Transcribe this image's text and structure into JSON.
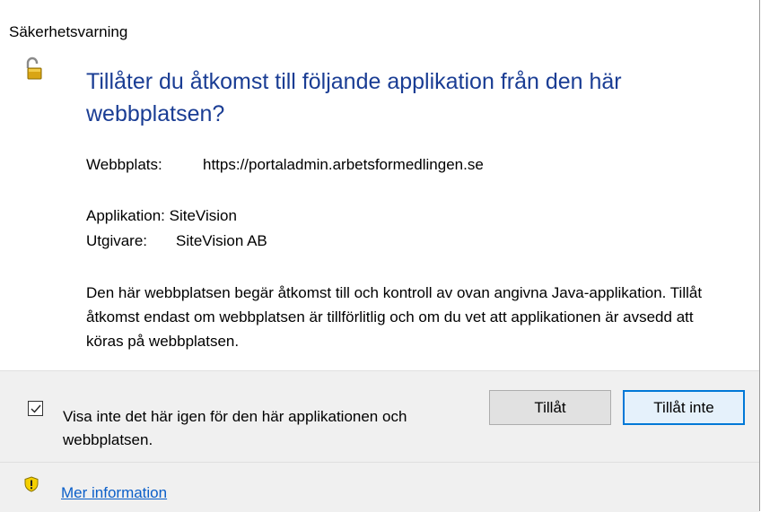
{
  "dialog": {
    "title": "Säkerhetsvarning",
    "heading": "Tillåter du åtkomst till följande applikation från den här webbplatsen?",
    "site_label": "Webbplats:",
    "site_value": "https://portaladmin.arbetsformedlingen.se",
    "app_label": "Applikation:",
    "app_value": "SiteVision",
    "publisher_label": "Utgivare:",
    "publisher_value": "SiteVision AB",
    "description": "Den här webbplatsen begär åtkomst till och kontroll av ovan angivna Java-applikation. Tillåt åtkomst endast om webbplatsen är tillförlitlig och om du vet att applikationen är avsedd att köras på webbplatsen."
  },
  "footer": {
    "checkbox_label": "Visa inte det här igen för den här applikationen och webbplatsen.",
    "checkbox_checked": true,
    "allow_button": "Tillåt",
    "deny_button": "Tillåt inte",
    "more_info_link": "Mer information"
  },
  "colors": {
    "heading": "#1a3d94",
    "link": "#0b5fc9",
    "focus_border": "#0078d7"
  },
  "icons": {
    "lock": "unlocked-padlock-icon",
    "shield": "warning-shield-icon"
  }
}
